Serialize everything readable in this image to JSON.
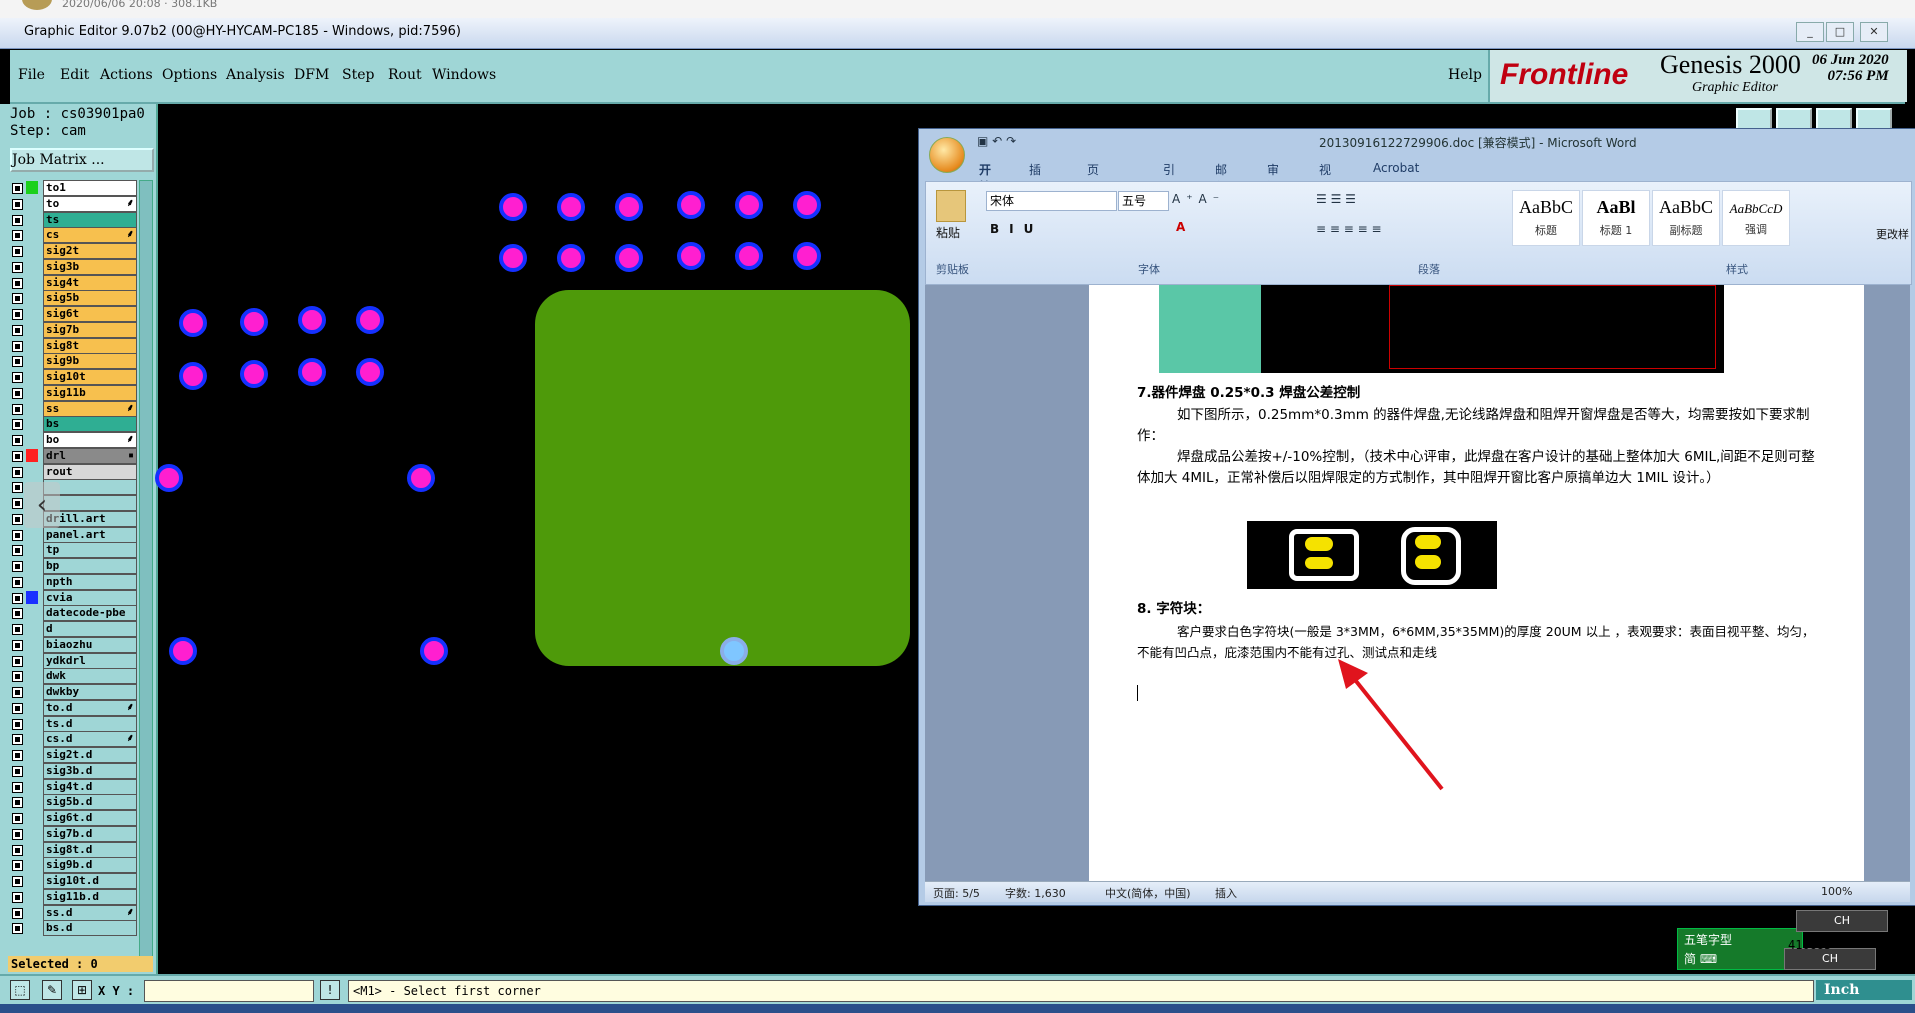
{
  "top_strip": {
    "meta": "2020/06/06 20:08 · 308.1KB"
  },
  "window": {
    "title": "Graphic Editor 9.07b2 (00@HY-HYCAM-PC185 - Windows, pid:7596)",
    "controls": [
      "_",
      "□",
      "✕"
    ]
  },
  "menu": {
    "items": [
      "File",
      "Edit",
      "Actions",
      "Options",
      "Analysis",
      "DFM",
      "Step",
      "Rout",
      "Windows"
    ],
    "help": "Help"
  },
  "brand": {
    "logo": "Frontline",
    "product": "Genesis 2000",
    "subtitle": "Graphic Editor",
    "date": "06 Jun 2020",
    "time": "07:56 PM"
  },
  "job": {
    "job_line": "Job : cs03901pa0",
    "step_line": "Step: cam",
    "matrix_button": "Job Matrix ..."
  },
  "layers": [
    {
      "name": "to1",
      "color": "#ffffff",
      "swatch": "#1bd01b",
      "mark": ""
    },
    {
      "name": "to",
      "color": "#ffffff",
      "swatch": "",
      "mark": "⸙"
    },
    {
      "name": "ts",
      "color": "#2fae93",
      "swatch": "",
      "mark": ""
    },
    {
      "name": "cs",
      "color": "#f7c04e",
      "swatch": "",
      "mark": "⸙"
    },
    {
      "name": "sig2t",
      "color": "#f7c04e",
      "swatch": "",
      "mark": ""
    },
    {
      "name": "sig3b",
      "color": "#f7c04e",
      "swatch": "",
      "mark": ""
    },
    {
      "name": "sig4t",
      "color": "#f7c04e",
      "swatch": "",
      "mark": ""
    },
    {
      "name": "sig5b",
      "color": "#f7c04e",
      "swatch": "",
      "mark": ""
    },
    {
      "name": "sig6t",
      "color": "#f7c04e",
      "swatch": "",
      "mark": ""
    },
    {
      "name": "sig7b",
      "color": "#f7c04e",
      "swatch": "",
      "mark": ""
    },
    {
      "name": "sig8t",
      "color": "#f7c04e",
      "swatch": "",
      "mark": ""
    },
    {
      "name": "sig9b",
      "color": "#f7c04e",
      "swatch": "",
      "mark": ""
    },
    {
      "name": "sig10t",
      "color": "#f7c04e",
      "swatch": "",
      "mark": ""
    },
    {
      "name": "sig11b",
      "color": "#f7c04e",
      "swatch": "",
      "mark": ""
    },
    {
      "name": "ss",
      "color": "#f7c04e",
      "swatch": "",
      "mark": "⸙"
    },
    {
      "name": "bs",
      "color": "#2fae93",
      "swatch": "",
      "mark": ""
    },
    {
      "name": "bo",
      "color": "#ffffff",
      "swatch": "",
      "mark": "⸙"
    },
    {
      "name": "drl",
      "color": "#8a8a8a",
      "swatch": "#ff2020",
      "mark": "▪"
    },
    {
      "name": "rout",
      "color": "#d8d8d8",
      "swatch": "",
      "mark": ""
    },
    {
      "name": "",
      "color": "#9fd6d6",
      "swatch": "",
      "mark": ""
    },
    {
      "name": "",
      "color": "#9fd6d6",
      "swatch": "",
      "mark": ""
    },
    {
      "name": "drill.art",
      "color": "#9fd6d6",
      "swatch": "",
      "mark": ""
    },
    {
      "name": "panel.art",
      "color": "#9fd6d6",
      "swatch": "",
      "mark": ""
    },
    {
      "name": "tp",
      "color": "#9fd6d6",
      "swatch": "",
      "mark": ""
    },
    {
      "name": "bp",
      "color": "#9fd6d6",
      "swatch": "",
      "mark": ""
    },
    {
      "name": "npth",
      "color": "#9fd6d6",
      "swatch": "",
      "mark": ""
    },
    {
      "name": "cvia",
      "color": "#9fd6d6",
      "swatch": "#1a30ff",
      "mark": ""
    },
    {
      "name": "datecode-pbe",
      "color": "#9fd6d6",
      "swatch": "",
      "mark": ""
    },
    {
      "name": "d",
      "color": "#9fd6d6",
      "swatch": "",
      "mark": ""
    },
    {
      "name": "biaozhu",
      "color": "#9fd6d6",
      "swatch": "",
      "mark": ""
    },
    {
      "name": "ydkdrl",
      "color": "#9fd6d6",
      "swatch": "",
      "mark": ""
    },
    {
      "name": "dwk",
      "color": "#9fd6d6",
      "swatch": "",
      "mark": ""
    },
    {
      "name": "dwkby",
      "color": "#9fd6d6",
      "swatch": "",
      "mark": ""
    },
    {
      "name": "to.d",
      "color": "#9fd6d6",
      "swatch": "",
      "mark": "⸙"
    },
    {
      "name": "ts.d",
      "color": "#9fd6d6",
      "swatch": "",
      "mark": ""
    },
    {
      "name": "cs.d",
      "color": "#9fd6d6",
      "swatch": "",
      "mark": "⸙"
    },
    {
      "name": "sig2t.d",
      "color": "#9fd6d6",
      "swatch": "",
      "mark": ""
    },
    {
      "name": "sig3b.d",
      "color": "#9fd6d6",
      "swatch": "",
      "mark": ""
    },
    {
      "name": "sig4t.d",
      "color": "#9fd6d6",
      "swatch": "",
      "mark": ""
    },
    {
      "name": "sig5b.d",
      "color": "#9fd6d6",
      "swatch": "",
      "mark": ""
    },
    {
      "name": "sig6t.d",
      "color": "#9fd6d6",
      "swatch": "",
      "mark": ""
    },
    {
      "name": "sig7b.d",
      "color": "#9fd6d6",
      "swatch": "",
      "mark": ""
    },
    {
      "name": "sig8t.d",
      "color": "#9fd6d6",
      "swatch": "",
      "mark": ""
    },
    {
      "name": "sig9b.d",
      "color": "#9fd6d6",
      "swatch": "",
      "mark": ""
    },
    {
      "name": "sig10t.d",
      "color": "#9fd6d6",
      "swatch": "",
      "mark": ""
    },
    {
      "name": "sig11b.d",
      "color": "#9fd6d6",
      "swatch": "",
      "mark": ""
    },
    {
      "name": "ss.d",
      "color": "#9fd6d6",
      "swatch": "",
      "mark": "⸙"
    },
    {
      "name": "bs.d",
      "color": "#9fd6d6",
      "swatch": "",
      "mark": ""
    }
  ],
  "selected": "Selected : 0",
  "word": {
    "title": "20130916122729906.doc [兼容模式] - Microsoft Word",
    "tabs": [
      "开始",
      "插入",
      "页面布局",
      "引用",
      "邮件",
      "审阅",
      "视图",
      "Acrobat"
    ],
    "groups": [
      "剪贴板",
      "字体",
      "段落",
      "样式"
    ],
    "paste": "粘贴",
    "font_name": "宋体",
    "font_size": "五号",
    "styles": [
      {
        "preview": "AaBbC",
        "label": "标题"
      },
      {
        "preview": "AaBl",
        "label": "标题 1"
      },
      {
        "preview": "AaBbC",
        "label": "副标题"
      },
      {
        "preview": "AaBbCcD",
        "label": "强调"
      }
    ],
    "change_styles": "更改样",
    "doc": {
      "h7": "7.器件焊盘 0.25*0.3 焊盘公差控制",
      "p7a": "如下图所示，0.25mm*0.3mm 的器件焊盘,无论线路焊盘和阻焊开窗焊盘是否等大，均需要按如下要求制作：",
      "p7b": "焊盘成品公差按+/-10%控制，（技术中心评审，此焊盘在客户设计的基础上整体加大 6MIL,间距不足则可整体加大 4MIL，正常补偿后以阻焊限定的方式制作，其中阻焊开窗比客户原搞单边大 1MIL 设计。）",
      "h8": "8. 字符块：",
      "p8": "客户要求白色字符块(一般是 3*3MM，6*6MM,35*35MM)的厚度 20UM 以上 ，表观要求：表面目视平整、均匀，不能有凹凸点，庇漆范围内不能有过孔、测试点和走线"
    },
    "status": {
      "page": "页面: 5/5",
      "words": "字数: 1,630",
      "lang": "中文(简体，中国)",
      "mode": "插入",
      "zoom": "100%"
    }
  },
  "bottom": {
    "xy_label": "X Y :",
    "message": "<M1> - Select first corner",
    "units": "Inch"
  },
  "ime": {
    "line1": "五笔字型",
    "line2": "简 ⌨",
    "ch": "CH"
  },
  "coord_readout": "410685"
}
